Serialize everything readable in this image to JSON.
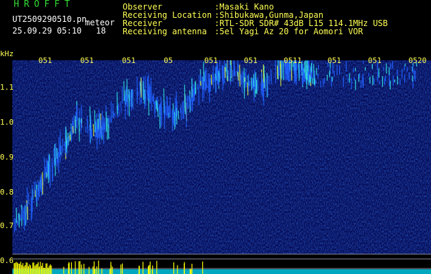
{
  "app": {
    "name": "HROFFT"
  },
  "file": {
    "name": "UT2509290510.pn",
    "source_type": "meteor",
    "datetime": "25.09.29 05:10",
    "count": "18"
  },
  "meta": [
    {
      "label": "Observer",
      "value": ":Masaki Kano"
    },
    {
      "label": "Receiving Location",
      "value": ":Shibukawa,Gunma,Japan"
    },
    {
      "label": "Receiver",
      "value": ":RTL-SDR SDR# 43dB L15 114.1MHz USB"
    },
    {
      "label": "Receiving antenna",
      "value": ":5el Yagi Az 20 for Aomori VOR"
    }
  ],
  "chart_data": {
    "type": "heatmap",
    "ylabel": "kHz",
    "y_ticks": [
      "1.1",
      "1.0",
      "0.9",
      "0.8",
      "0.7",
      "0.6"
    ],
    "x_ticks": [
      "051",
      "051",
      "051",
      "05",
      "051",
      "051",
      "0511",
      "051",
      "051",
      "0520"
    ],
    "colors": {
      "background": "#000000",
      "noise": "#0a1e96",
      "signal": "#2060ff",
      "strong": "#30e0e0",
      "peak": "#d8f040",
      "text": "#ffff55",
      "amplitude_bar": "#ffff00",
      "amplitude_floor": "#00e0ff"
    }
  }
}
